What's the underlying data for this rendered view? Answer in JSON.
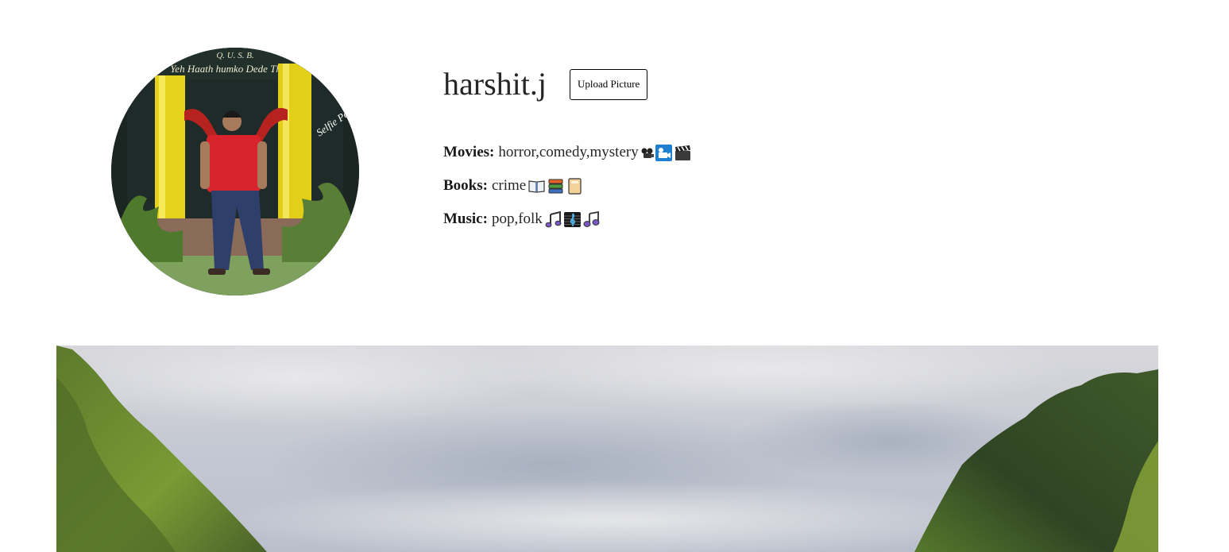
{
  "profile": {
    "username": "harshit.j",
    "upload_label": "Upload Picture",
    "avatar_caption_top": "Q. U. S. B.",
    "avatar_caption_banner": "Yeh Haath humko Dede Thakur",
    "avatar_caption_side": "Selfie Point"
  },
  "interests": {
    "movies": {
      "label": "Movies:",
      "value": "horror,comedy,mystery",
      "icons": [
        "projector-icon",
        "cinema-icon",
        "clapperboard-icon"
      ]
    },
    "books": {
      "label": "Books:",
      "value": "crime",
      "icons": [
        "open-book-icon",
        "books-stack-icon",
        "notebook-icon"
      ]
    },
    "music": {
      "label": "Music:",
      "value": "pop,folk",
      "icons": [
        "music-note-icon",
        "treble-clef-icon",
        "music-notes-icon"
      ]
    }
  },
  "colors": {
    "text": "#262626",
    "button_border": "#000000",
    "background": "#ffffff"
  }
}
